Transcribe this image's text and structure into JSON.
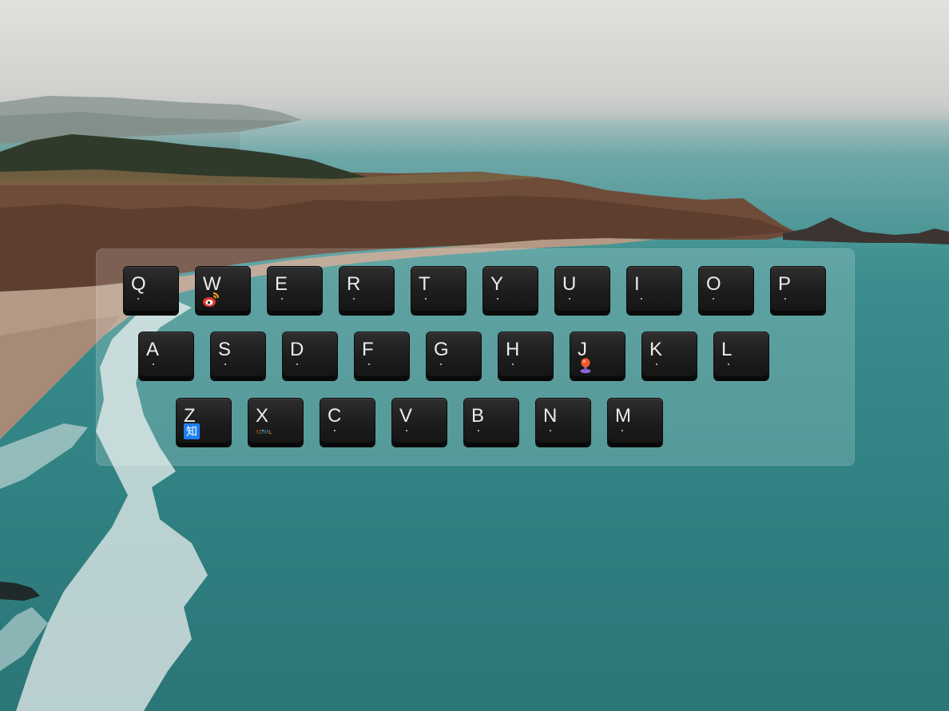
{
  "colors": {
    "key_face": "#1f1f1f",
    "key_text": "#ececec",
    "panel_overlay": "rgba(255,255,255,0.18)",
    "sea": "#358787",
    "sky": "#d6d6d3"
  },
  "keyboard": {
    "rows": [
      [
        {
          "label": "Q"
        },
        {
          "label": "W",
          "icon": "weibo-icon"
        },
        {
          "label": "E"
        },
        {
          "label": "R"
        },
        {
          "label": "T"
        },
        {
          "label": "Y"
        },
        {
          "label": "U"
        },
        {
          "label": "I"
        },
        {
          "label": "O"
        },
        {
          "label": "P"
        }
      ],
      [
        {
          "label": "A"
        },
        {
          "label": "S"
        },
        {
          "label": "D"
        },
        {
          "label": "F"
        },
        {
          "label": "G"
        },
        {
          "label": "H"
        },
        {
          "label": "J",
          "icon": "juejin-pin-icon"
        },
        {
          "label": "K"
        },
        {
          "label": "L"
        }
      ],
      [
        {
          "label": "Z",
          "icon": "zhihu-icon",
          "icon_text": "知"
        },
        {
          "label": "X",
          "icon": "xdml-logo-icon",
          "icon_text": "XDML"
        },
        {
          "label": "C"
        },
        {
          "label": "V"
        },
        {
          "label": "B"
        },
        {
          "label": "N"
        },
        {
          "label": "M"
        }
      ]
    ]
  }
}
